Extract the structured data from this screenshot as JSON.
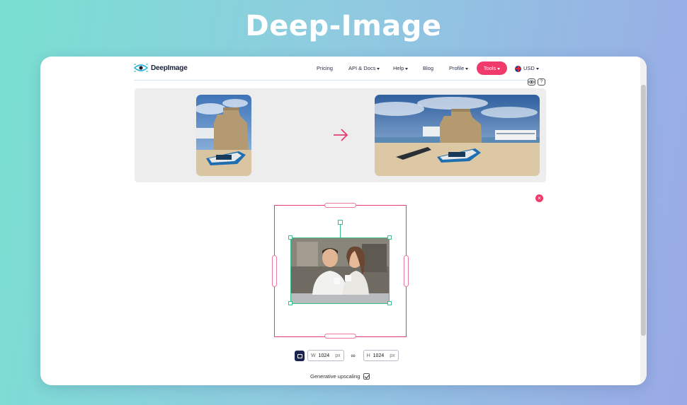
{
  "banner": {
    "title": "Deep-Image"
  },
  "nav": {
    "logo_text": "DeepImage",
    "items": [
      {
        "label": "Pricing",
        "dropdown": false
      },
      {
        "label": "API & Docs",
        "dropdown": true
      },
      {
        "label": "Help",
        "dropdown": true
      },
      {
        "label": "Blog",
        "dropdown": false
      },
      {
        "label": "Profile",
        "dropdown": true
      }
    ],
    "tools_label": "Tools",
    "currency_label": "USD",
    "accent_color": "#f03a6b"
  },
  "toolbar_icons": [
    "eye-icon",
    "help-icon"
  ],
  "help_glyph": "?",
  "compare": {
    "before_image": "castle-beach-boat-small",
    "after_image": "castle-beach-boats-wide",
    "arrow_icon": "arrow-right-icon"
  },
  "editor": {
    "photo": "couple-with-coffee-cups",
    "close_glyph": "×"
  },
  "controls": {
    "width_label": "W",
    "width_value": "1024",
    "width_unit": "px",
    "height_label": "H",
    "height_value": "1024",
    "height_unit": "px",
    "link_glyph": "∞"
  },
  "generative": {
    "label": "Generative upscaling",
    "checked": true
  }
}
